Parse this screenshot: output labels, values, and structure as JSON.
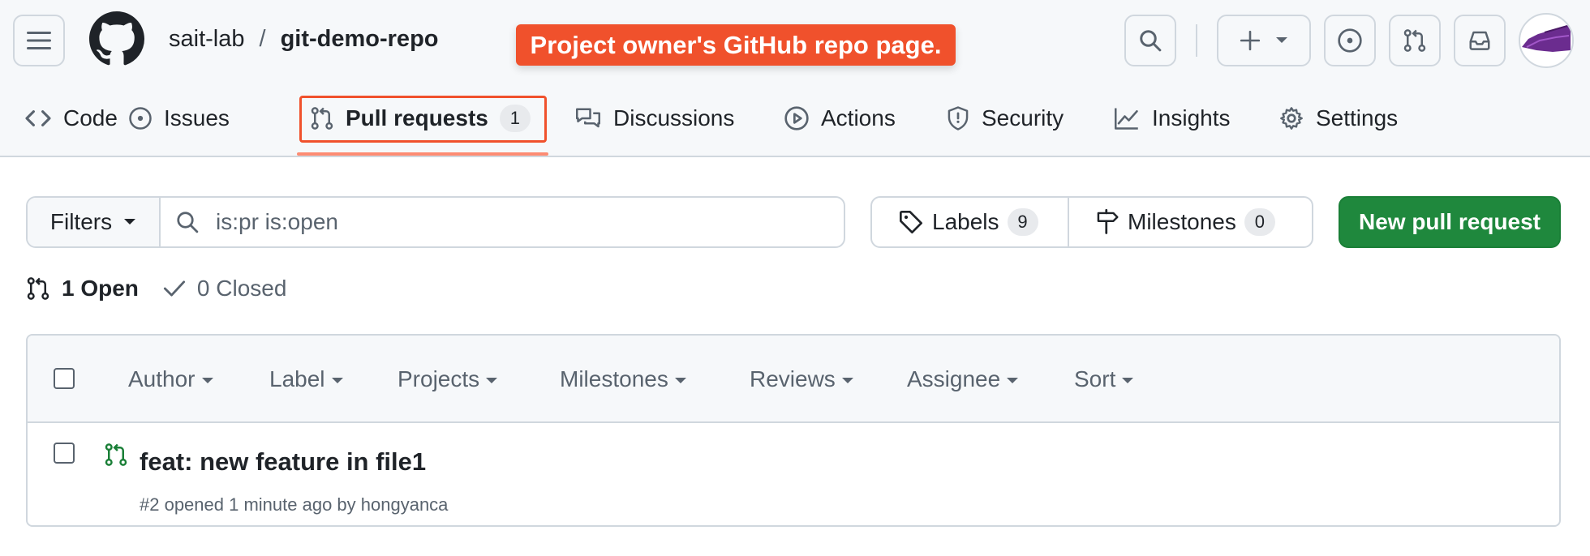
{
  "header": {
    "owner": "sait-lab",
    "separator": "/",
    "repo": "git-demo-repo",
    "callout": "Project owner's GitHub repo page."
  },
  "tabs": [
    {
      "label": "Code",
      "icon": "code-icon"
    },
    {
      "label": "Issues",
      "icon": "issue-icon"
    },
    {
      "label": "Pull requests",
      "icon": "pull-request-icon",
      "count": "1",
      "active": true
    },
    {
      "label": "Discussions",
      "icon": "discussion-icon"
    },
    {
      "label": "Actions",
      "icon": "play-icon"
    },
    {
      "label": "Security",
      "icon": "shield-icon"
    },
    {
      "label": "Insights",
      "icon": "graph-icon"
    },
    {
      "label": "Settings",
      "icon": "gear-icon"
    }
  ],
  "toolbar": {
    "filters_label": "Filters",
    "search_value": "is:pr is:open",
    "labels_label": "Labels",
    "labels_count": "9",
    "milestones_label": "Milestones",
    "milestones_count": "0",
    "new_pr_label": "New pull request"
  },
  "states": {
    "open_label": "1 Open",
    "closed_label": "0 Closed"
  },
  "list": {
    "filters": [
      "Author",
      "Label",
      "Projects",
      "Milestones",
      "Reviews",
      "Assignee",
      "Sort"
    ],
    "rows": [
      {
        "title": "feat: new feature in file1",
        "meta": "#2 opened 1 minute ago by hongyanca"
      }
    ]
  },
  "colors": {
    "accent_highlight": "#f0512c",
    "primary_button": "#1f883d",
    "open_icon": "#1a7f37",
    "tab_underline": "#fd8c73"
  }
}
